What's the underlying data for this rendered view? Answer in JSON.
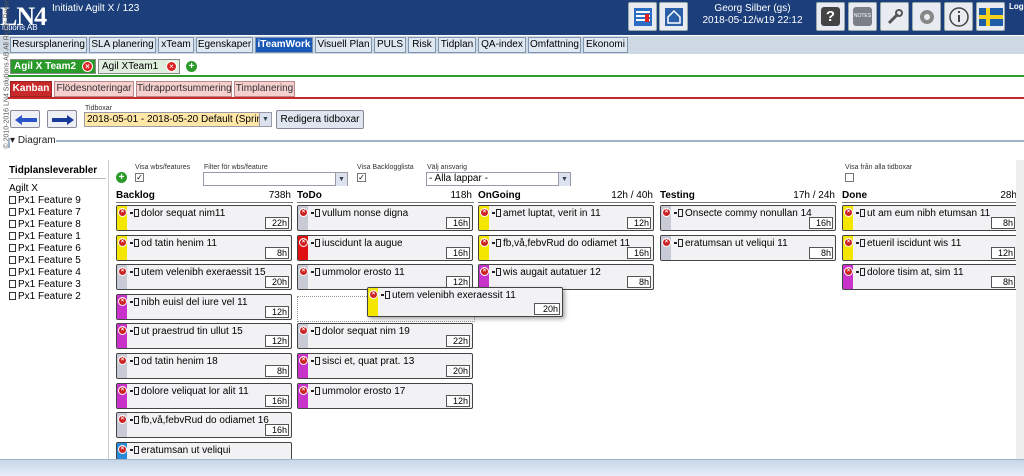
{
  "header": {
    "logo": "LN4",
    "logo_sub": "lutions AB",
    "app_title": "Initiativ Agilt X / 123",
    "user_name": "Georg Silber (gs)",
    "date_week": "2018-05-12/w19 22:12",
    "toolbar_icons": [
      "report-icon",
      "home-icon",
      "help-icon",
      "notes-icon",
      "tools-icon",
      "settings-gear-icon",
      "info-icon",
      "swedish-flag-icon"
    ],
    "logout_label": "Log out"
  },
  "menu_tabs": [
    "Resursplanering",
    "SLA planering",
    "xTeam",
    "Egenskaper",
    "iTeamWork",
    "Visuell Plan",
    "PULS",
    "Risk",
    "Tidplan",
    "QA-index",
    "Omfattning",
    "Ekonomi"
  ],
  "active_menu": "iTeamWork",
  "team_tabs": [
    {
      "label": "Agil X Team2",
      "active": true
    },
    {
      "label": "Agil XTeam1",
      "active": false
    }
  ],
  "sub_tabs": [
    "Kanban",
    "Flödesnoteringar",
    "Tidrapportsummering",
    "Timplanering"
  ],
  "active_sub": "Kanban",
  "side_rotated": "© 2010-2016 LN4 Solutions AB All Rights Reserved",
  "timebox": {
    "label": "Tidboxar",
    "selected": "2018-05-01 - 2018-05-20 Default (Sprint)",
    "edit_button": "Redigera tidboxar"
  },
  "diagram_label": "Diagram",
  "deliverables": {
    "title": "Tidplansleverabler",
    "root": "Agilt X",
    "items": [
      "Px1 Feature 9",
      "Px1 Feature 7",
      "Px1 Feature 8",
      "Px1 Feature 1",
      "Px1 Feature 6",
      "Px1 Feature 5",
      "Px1 Feature 4",
      "Px1 Feature 3",
      "Px1 Feature 2"
    ]
  },
  "filters": {
    "show_wbs": "Visa wbs/features",
    "show_wbs_checked": true,
    "filter_wbs": "Filter för wbs/feature",
    "filter_wbs_value": "",
    "show_backlog": "Visa Backlogglista",
    "show_backlog_checked": true,
    "responsible": "Välj ansvarig",
    "responsible_value": "- Alla lappar -",
    "show_all_timeboxes": "Visa från alla tidboxar",
    "show_all_checked": false
  },
  "colors": {
    "yellow": "#f5e600",
    "magenta": "#c832c8",
    "red": "#e01010",
    "blue": "#2a8ad8",
    "grey": "#c8cbd6"
  },
  "columns": [
    {
      "title": "Backlog",
      "hours": "738h",
      "cards": [
        {
          "text": "dolor sequat nim11",
          "hours": "22h",
          "color": "yellow"
        },
        {
          "text": "od tatin henim 11",
          "hours": "8h",
          "color": "yellow"
        },
        {
          "text": "utem velenibh exeraessit 15",
          "hours": "20h",
          "color": "grey"
        },
        {
          "text": "nibh euisl del iure vel 11",
          "hours": "12h",
          "color": "magenta"
        },
        {
          "text": "ut praestrud tin ullut 15",
          "hours": "12h",
          "color": "magenta"
        },
        {
          "text": "od tatin henim 18",
          "hours": "8h",
          "color": "grey"
        },
        {
          "text": "dolore veliquat lor alit 11",
          "hours": "16h",
          "color": "magenta"
        },
        {
          "text": "fb,vå,febvRud do odiamet 16",
          "hours": "16h",
          "color": "grey"
        },
        {
          "text": "eratumsan ut veliqui",
          "hours": "",
          "color": "blue"
        }
      ]
    },
    {
      "title": "ToDo",
      "hours": "118h",
      "cards": [
        {
          "text": "vullum nonse digna",
          "hours": "16h",
          "color": "grey"
        },
        {
          "text": "iuscidunt la augue",
          "hours": "16h",
          "color": "red"
        },
        {
          "text": "ummolor erosto 11",
          "hours": "12h",
          "color": "grey"
        },
        {
          "text": "",
          "hours": "",
          "color": "placeholder"
        },
        {
          "text": "dolor sequat nim 19",
          "hours": "22h",
          "color": "grey"
        },
        {
          "text": "sisci et, quat prat. 13",
          "hours": "20h",
          "color": "magenta"
        },
        {
          "text": "ummolor erosto 17",
          "hours": "12h",
          "color": "magenta"
        }
      ]
    },
    {
      "title": "OnGoing",
      "hours": "12h / 40h",
      "cards": [
        {
          "text": "amet luptat, verit in 11",
          "hours": "12h",
          "color": "yellow"
        },
        {
          "text": "fb,vå,febvRud do odiamet 11",
          "hours": "16h",
          "color": "yellow"
        },
        {
          "text": "wis augait autatuer 12",
          "hours": "8h",
          "color": "magenta"
        }
      ]
    },
    {
      "title": "Testing",
      "hours": "17h / 24h",
      "cards": [
        {
          "text": "Onsecte commy nonullan 14",
          "hours": "16h",
          "color": "grey"
        },
        {
          "text": "eratumsan ut veliqui 11",
          "hours": "8h",
          "color": "grey"
        }
      ]
    },
    {
      "title": "Done",
      "hours": "28h",
      "cards": [
        {
          "text": "ut am eum nibh etumsan 11",
          "hours": "8h",
          "color": "yellow"
        },
        {
          "text": "etueril iscidunt wis 11",
          "hours": "12h",
          "color": "yellow"
        },
        {
          "text": "dolore tisim at, sim 11",
          "hours": "8h",
          "color": "magenta"
        }
      ]
    }
  ],
  "dragged_card": {
    "text": "utem velenibh exeraessit 11",
    "hours": "20h",
    "color": "yellow"
  }
}
